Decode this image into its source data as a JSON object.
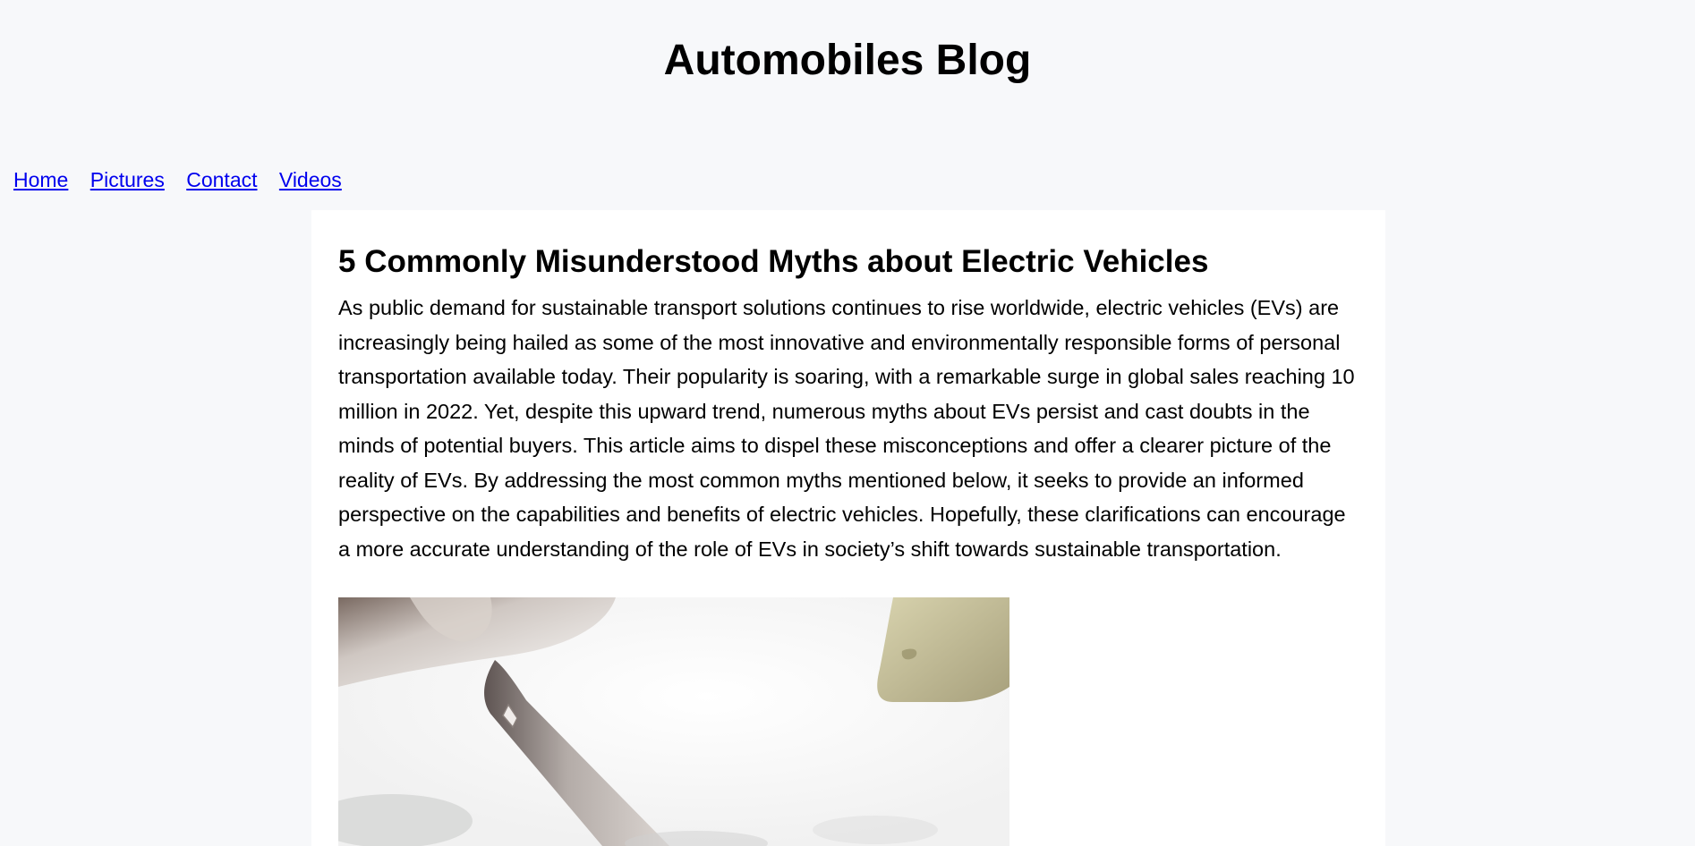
{
  "site": {
    "title": "Automobiles Blog"
  },
  "nav": {
    "items": [
      {
        "label": "Home"
      },
      {
        "label": "Pictures"
      },
      {
        "label": "Contact"
      },
      {
        "label": "Videos"
      }
    ]
  },
  "article": {
    "title": "5 Commonly Misunderstood Myths about Electric Vehicles",
    "body": "As public demand for sustainable transport solutions continues to rise worldwide, electric vehicles (EVs) are increasingly being hailed as some of the most innovative and environmentally responsible forms of personal transportation available today. Their popularity is soaring, with a remarkable surge in global sales reaching 10 million in 2022. Yet, despite this upward trend, numerous myths about EVs persist and cast doubts in the minds of potential buyers. This article aims to dispel these misconceptions and offer a clearer picture of the reality of EVs. By addressing the most common myths mentioned below, it seeks to provide an informed perspective on the capabilities and benefits of electric vehicles. Hopefully, these clarifications can encourage a more accurate understanding of the role of EVs in society’s shift towards sustainable transportation."
  },
  "colors": {
    "page_background": "#f7f8fa",
    "article_background": "#ffffff",
    "link": "#0000ee"
  }
}
